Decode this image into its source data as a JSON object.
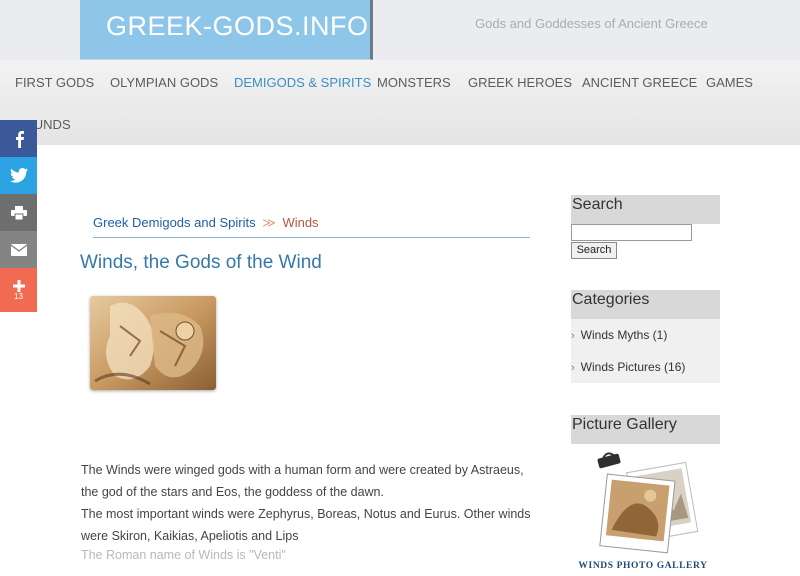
{
  "header": {
    "logo": "GREEK-GODS.INFO",
    "tagline": "Gods and Goddesses of Ancient Greece"
  },
  "nav": {
    "items": [
      {
        "label": "FIRST GODS"
      },
      {
        "label": "OLYMPIAN GODS"
      },
      {
        "label": "DEMIGODS & SPIRITS",
        "active": true
      },
      {
        "label": "MONSTERS"
      },
      {
        "label": "GREEK HEROES"
      },
      {
        "label": "ANCIENT GREECE"
      },
      {
        "label": "GAMES"
      },
      {
        "label": "SOUNDS"
      }
    ],
    "active_color": "#3a8fc4"
  },
  "social": {
    "buttons": [
      "facebook-icon",
      "twitter-icon",
      "print-icon",
      "email-icon",
      "plus-icon"
    ],
    "share_count": "13"
  },
  "breadcrumb": {
    "parent": "Greek Demigods and Spirits",
    "separator": "≫",
    "current": "Winds"
  },
  "page": {
    "title": "Winds, the Gods of the Wind",
    "paragraphs": [
      "The Winds were winged gods with a human form and were created by Astraeus,",
      "the god of the stars and Eos, the goddess of the dawn.",
      "The most important winds were Zephyrus, Boreas, Notus and Eurus. Other winds",
      "were Skiron, Kaikias, Apeliotis and Lips",
      "The Roman name of Winds is \"Venti\""
    ]
  },
  "sidebar": {
    "search": {
      "heading": "Search",
      "value": "",
      "button_label": "Search"
    },
    "categories": {
      "heading": "Categories",
      "items": [
        {
          "label": "Winds Myths (1)"
        },
        {
          "label": "Winds Pictures (16)"
        }
      ]
    },
    "gallery": {
      "heading": "Picture Gallery",
      "caption": "WINDS PHOTO GALLERY"
    }
  }
}
